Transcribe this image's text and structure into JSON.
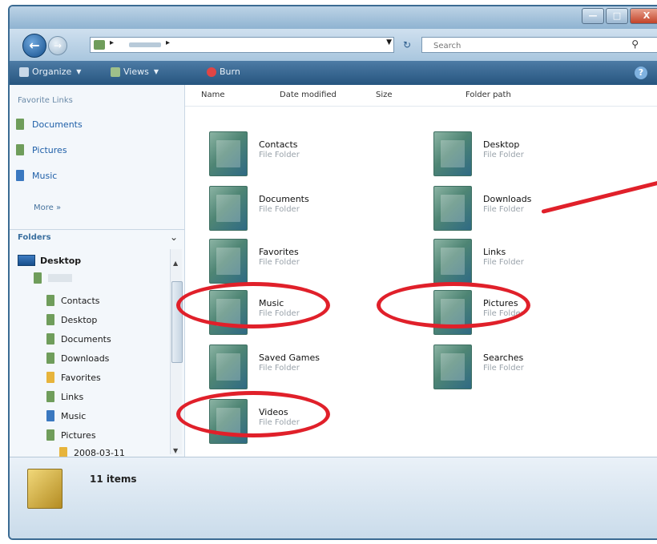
{
  "titlebar": {
    "buttons": {
      "minimize": "—",
      "maximize": "□",
      "close": "X"
    }
  },
  "address": {
    "search_placeholder": "Search"
  },
  "commandbar": {
    "organize": "Organize",
    "views": "Views",
    "burn": "Burn",
    "help": "?"
  },
  "navpane": {
    "favorite_links_heading": "Favorite Links",
    "favorites": [
      {
        "label": "Documents"
      },
      {
        "label": "Pictures"
      },
      {
        "label": "Music"
      }
    ],
    "more_label": "More »",
    "folders_label": "Folders",
    "tree": {
      "root": "Desktop",
      "children": [
        "Contacts",
        "Desktop",
        "Documents",
        "Downloads",
        "Favorites",
        "Links",
        "Music",
        "Pictures"
      ],
      "subfolder": "2008-03-11"
    }
  },
  "columns": {
    "name": "Name",
    "date_modified": "Date modified",
    "size": "Size",
    "folder_path": "Folder path"
  },
  "folders": [
    {
      "name": "Contacts",
      "type": "File Folder"
    },
    {
      "name": "Desktop",
      "type": "File Folder"
    },
    {
      "name": "Documents",
      "type": "File Folder"
    },
    {
      "name": "Downloads",
      "type": "File Folder"
    },
    {
      "name": "Favorites",
      "type": "File Folder"
    },
    {
      "name": "Links",
      "type": "File Folder"
    },
    {
      "name": "Music",
      "type": "File Folder"
    },
    {
      "name": "Pictures",
      "type": "File Folder"
    },
    {
      "name": "Saved Games",
      "type": "File Folder"
    },
    {
      "name": "Searches",
      "type": "File Folder"
    },
    {
      "name": "Videos",
      "type": "File Folder"
    }
  ],
  "status": {
    "item_count": "11 items"
  },
  "annotation_color": "#e0202a"
}
